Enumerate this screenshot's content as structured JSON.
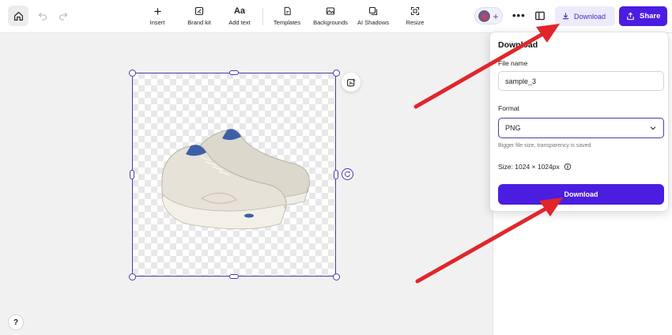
{
  "toolbar": {
    "tools": [
      {
        "label": "Insert",
        "icon": "plus-icon"
      },
      {
        "label": "Brand kit",
        "icon": "brand-kit-icon"
      },
      {
        "label": "Add text",
        "icon": "text-icon",
        "glyph": "Aa"
      },
      {
        "label": "Templates",
        "icon": "templates-icon"
      },
      {
        "label": "Backgrounds",
        "icon": "backgrounds-icon"
      },
      {
        "label": "AI Shadows",
        "icon": "ai-shadows-icon"
      },
      {
        "label": "Resize",
        "icon": "resize-icon"
      }
    ],
    "download_label": "Download",
    "share_label": "Share"
  },
  "download_panel": {
    "title": "Download",
    "file_name_label": "File name",
    "file_name_value": "sample_3",
    "format_label": "Format",
    "format_value": "PNG",
    "format_hint": "Bigger file size, transparency is saved",
    "size_text": "Size: 1024 × 1024px",
    "download_button": "Download"
  },
  "help_label": "?",
  "colors": {
    "accent": "#4b1de1",
    "selection": "#4a3aa8",
    "annotation_arrow": "#e0262b"
  }
}
